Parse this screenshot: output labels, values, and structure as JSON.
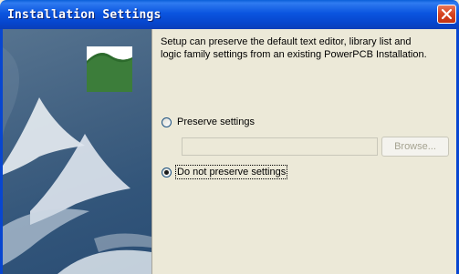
{
  "window": {
    "title": "Installation Settings"
  },
  "controls": {
    "close": "close"
  },
  "main": {
    "intro": "Setup can preserve the default text editor, library list and logic family settings from an existing PowerPCB Installation.",
    "options": [
      {
        "label": "Preserve settings",
        "selected": false
      },
      {
        "label": "Do not preserve settings",
        "selected": true
      }
    ],
    "path_input": {
      "value": "",
      "placeholder": "",
      "enabled": false
    },
    "browse_label": "Browse...",
    "browse_enabled": false
  },
  "icons": [
    "close-icon",
    "installer-logo-icon"
  ],
  "colors": {
    "titlebar": "#0b55e0",
    "dialog_bg": "#ece9d8",
    "logo_green": "#3c7d3a"
  }
}
